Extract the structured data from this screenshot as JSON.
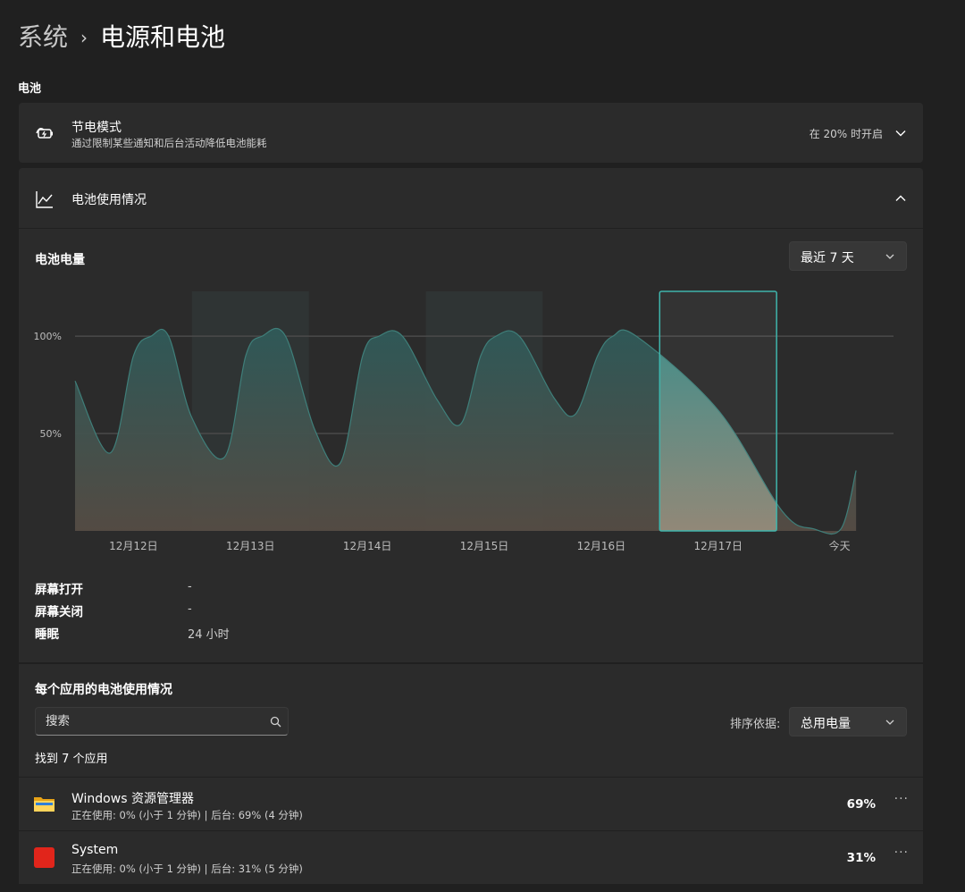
{
  "breadcrumb": {
    "parent": "系统",
    "separator": "›",
    "current": "电源和电池"
  },
  "section": {
    "label": "电池"
  },
  "battery_saver": {
    "title": "节电模式",
    "subtitle": "通过限制某些通知和后台活动降低电池能耗",
    "value": "在 20% 时开启",
    "icon": "battery-saver-icon"
  },
  "battery_usage": {
    "title": "电池使用情况",
    "icon": "line-chart-icon"
  },
  "chart_panel": {
    "title": "电池电量",
    "range_select": "最近 7 天"
  },
  "stats": [
    {
      "label": "屏幕打开",
      "value": "-"
    },
    {
      "label": "屏幕关闭",
      "value": "-"
    },
    {
      "label": "睡眠",
      "value": "24 小时"
    }
  ],
  "apps": {
    "title": "每个应用的电池使用情况",
    "search_placeholder": "搜索",
    "sort_label": "排序依据:",
    "sort_value": "总用电量",
    "found": "找到 7 个应用",
    "items": [
      {
        "name": "Windows 资源管理器",
        "detail": "正在使用: 0% (小于 1 分钟) | 后台: 69% (4 分钟)",
        "percent": "69%",
        "icon": "file-explorer-icon",
        "more": "···"
      },
      {
        "name": "System",
        "detail": "正在使用: 0% (小于 1 分钟) | 后台: 31% (5 分钟)",
        "percent": "31%",
        "icon": "system-app-icon",
        "more": "···"
      }
    ]
  },
  "colors": {
    "background": "#202020",
    "card": "#2b2b2b",
    "accent_teal": "#3fb5ac",
    "system_icon_red": "#e1251b"
  },
  "chart_data": {
    "type": "area",
    "title": "电池电量",
    "categories": [
      "12月12日",
      "12月13日",
      "12月14日",
      "12月15日",
      "12月16日",
      "12月17日",
      "今天"
    ],
    "yticks": [
      {
        "value": 100,
        "label": "100%"
      },
      {
        "value": 50,
        "label": "50%"
      }
    ],
    "ylim": [
      0,
      123
    ],
    "xlim": [
      -0.5,
      6.5
    ],
    "grid": true,
    "shaded_days": [
      1,
      3
    ],
    "selected_day": 5,
    "series": [
      {
        "points": [
          [
            -0.5,
            77
          ],
          [
            -0.2,
            40
          ],
          [
            0.0,
            90
          ],
          [
            0.15,
            100
          ],
          [
            0.3,
            100
          ],
          [
            0.5,
            58
          ],
          [
            0.78,
            38
          ],
          [
            0.96,
            90
          ],
          [
            1.1,
            100
          ],
          [
            1.3,
            100
          ],
          [
            1.55,
            52
          ],
          [
            1.77,
            35
          ],
          [
            1.96,
            90
          ],
          [
            2.1,
            100
          ],
          [
            2.3,
            100
          ],
          [
            2.6,
            67
          ],
          [
            2.8,
            55
          ],
          [
            2.97,
            90
          ],
          [
            3.1,
            100
          ],
          [
            3.3,
            100
          ],
          [
            3.6,
            68
          ],
          [
            3.78,
            60
          ],
          [
            3.97,
            90
          ],
          [
            4.1,
            100
          ],
          [
            4.3,
            100
          ],
          [
            5.0,
            62
          ],
          [
            5.55,
            10
          ],
          [
            5.82,
            1
          ],
          [
            6.05,
            1
          ],
          [
            6.18,
            31
          ]
        ]
      }
    ]
  }
}
